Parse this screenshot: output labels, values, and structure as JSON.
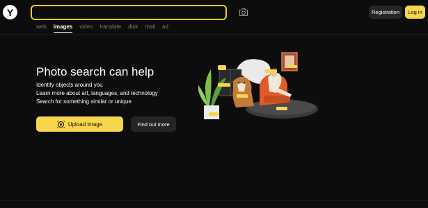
{
  "header": {
    "logo_letter": "Y",
    "search_placeholder": "",
    "registration_label": "Registration",
    "login_label": "Log in",
    "camera_icon": "camera-icon"
  },
  "tabs": [
    {
      "label": "web",
      "active": false
    },
    {
      "label": "images",
      "active": true
    },
    {
      "label": "video",
      "active": false
    },
    {
      "label": "translate",
      "active": false
    },
    {
      "label": "disk",
      "active": false
    },
    {
      "label": "mail",
      "active": false
    },
    {
      "label": "ad",
      "active": false
    }
  ],
  "hero": {
    "title": "Photo search can help",
    "features": [
      "Identify objects around you",
      "Learn more about art, languages, and technology",
      "Search for something similar or unique"
    ],
    "upload_label": "Upload image",
    "find_out_label": "Find out more"
  },
  "colors": {
    "background": "#0d0d0d",
    "accent_yellow": "#f7d54c",
    "search_border": "#f5cc2c",
    "secondary_button": "#252525"
  }
}
